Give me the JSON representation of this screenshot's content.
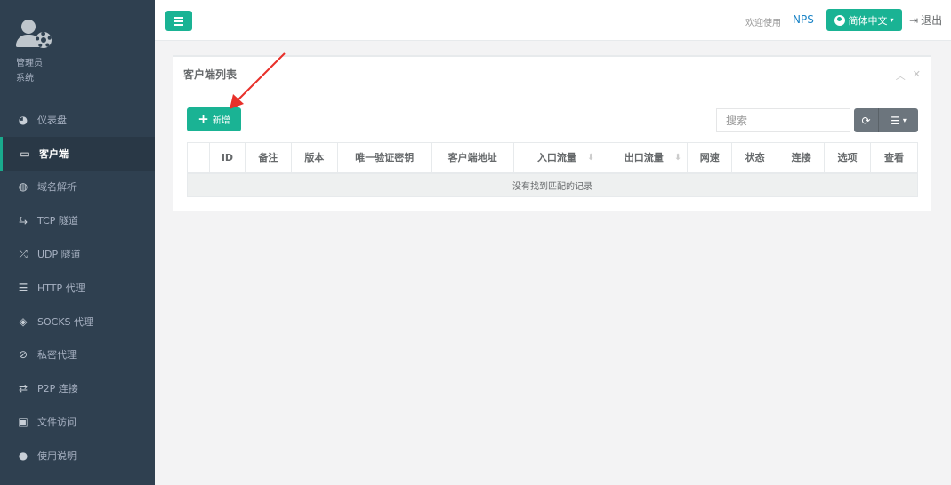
{
  "sidebar": {
    "profile": {
      "name": "管理员",
      "role": "系统"
    },
    "items": [
      {
        "label": "仪表盘",
        "icon": "dashboard-icon",
        "glyph": "◕"
      },
      {
        "label": "客户端",
        "icon": "monitor-icon",
        "glyph": "▭"
      },
      {
        "label": "域名解析",
        "icon": "globe-icon",
        "glyph": "◍"
      },
      {
        "label": "TCP 隧道",
        "icon": "retweet-icon",
        "glyph": "⇆"
      },
      {
        "label": "UDP 隧道",
        "icon": "random-icon",
        "glyph": "⤮"
      },
      {
        "label": "HTTP 代理",
        "icon": "server-icon",
        "glyph": "☰"
      },
      {
        "label": "SOCKS 代理",
        "icon": "layers-icon",
        "glyph": "◈"
      },
      {
        "label": "私密代理",
        "icon": "eye-slash-icon",
        "glyph": "⊘"
      },
      {
        "label": "P2P 连接",
        "icon": "exchange-icon",
        "glyph": "⇄"
      },
      {
        "label": "文件访问",
        "icon": "briefcase-icon",
        "glyph": "▣"
      },
      {
        "label": "使用说明",
        "icon": "lightbulb-icon",
        "glyph": "●"
      }
    ]
  },
  "topbar": {
    "welcome": "欢迎使用",
    "brand": "NPS",
    "language": "简体中文",
    "logout": "退出"
  },
  "panel": {
    "title": "客户端列表",
    "add_label": "新增",
    "search_placeholder": "搜索",
    "columns": [
      "",
      "ID",
      "备注",
      "版本",
      "唯一验证密钥",
      "客户端地址",
      "入口流量",
      "出口流量",
      "网速",
      "状态",
      "连接",
      "选项",
      "查看"
    ],
    "empty_message": "没有找到匹配的记录"
  },
  "colors": {
    "sidebar_bg": "#2f4050",
    "accent": "#1ab394",
    "link": "#1c84c6",
    "annotation_arrow": "#e8302a"
  }
}
